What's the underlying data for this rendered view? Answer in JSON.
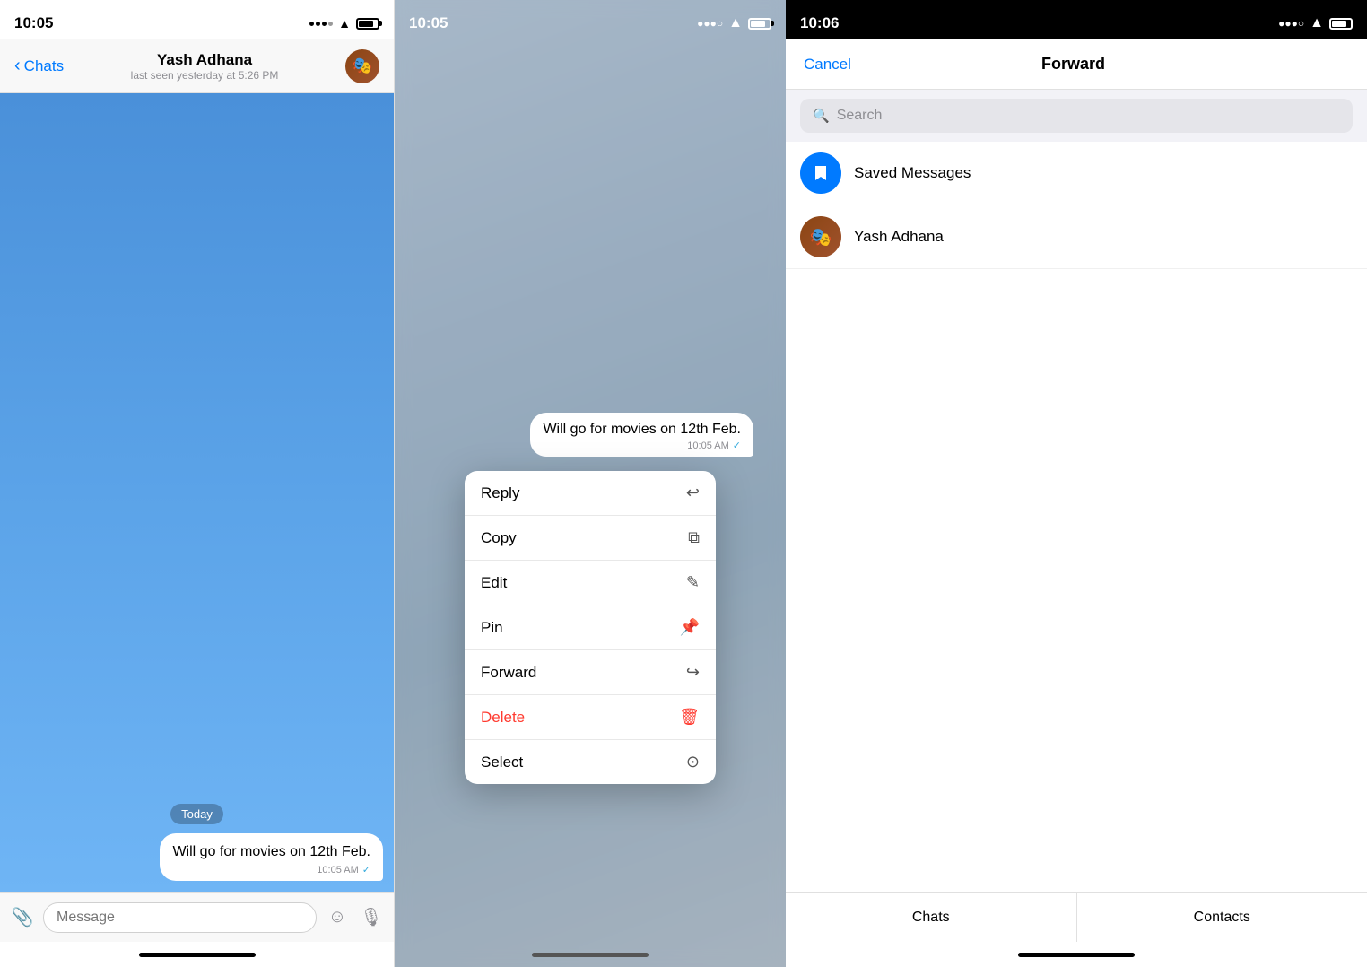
{
  "panel1": {
    "status_time": "10:05",
    "header": {
      "back_label": "Chats",
      "contact_name": "Yash Adhana",
      "contact_status": "last seen yesterday at 5:26 PM"
    },
    "chat": {
      "today_label": "Today",
      "message_text": "Will go for movies on 12th Feb.",
      "message_time": "10:05 AM",
      "message_check": "✓"
    },
    "input": {
      "placeholder": "Message"
    }
  },
  "panel2": {
    "status_time": "10:05",
    "message_text": "Will go for movies on 12th Feb.",
    "message_time": "10:05 AM",
    "message_check": "✓",
    "menu_items": [
      {
        "label": "Reply",
        "icon": "↩",
        "type": "normal"
      },
      {
        "label": "Copy",
        "icon": "⧉",
        "type": "normal"
      },
      {
        "label": "Edit",
        "icon": "✎",
        "type": "normal"
      },
      {
        "label": "Pin",
        "icon": "⚲",
        "type": "normal"
      },
      {
        "label": "Forward",
        "icon": "↪",
        "type": "normal"
      },
      {
        "label": "Delete",
        "icon": "🗑",
        "type": "delete"
      },
      {
        "label": "Select",
        "icon": "⊙",
        "type": "normal"
      }
    ]
  },
  "panel3": {
    "status_time": "10:06",
    "header": {
      "cancel_label": "Cancel",
      "title": "Forward"
    },
    "search": {
      "placeholder": "Search"
    },
    "contacts": [
      {
        "name": "Saved Messages",
        "avatar_type": "saved"
      },
      {
        "name": "Yash Adhana",
        "avatar_type": "yash"
      }
    ],
    "tabs": [
      {
        "label": "Chats"
      },
      {
        "label": "Contacts"
      }
    ]
  }
}
